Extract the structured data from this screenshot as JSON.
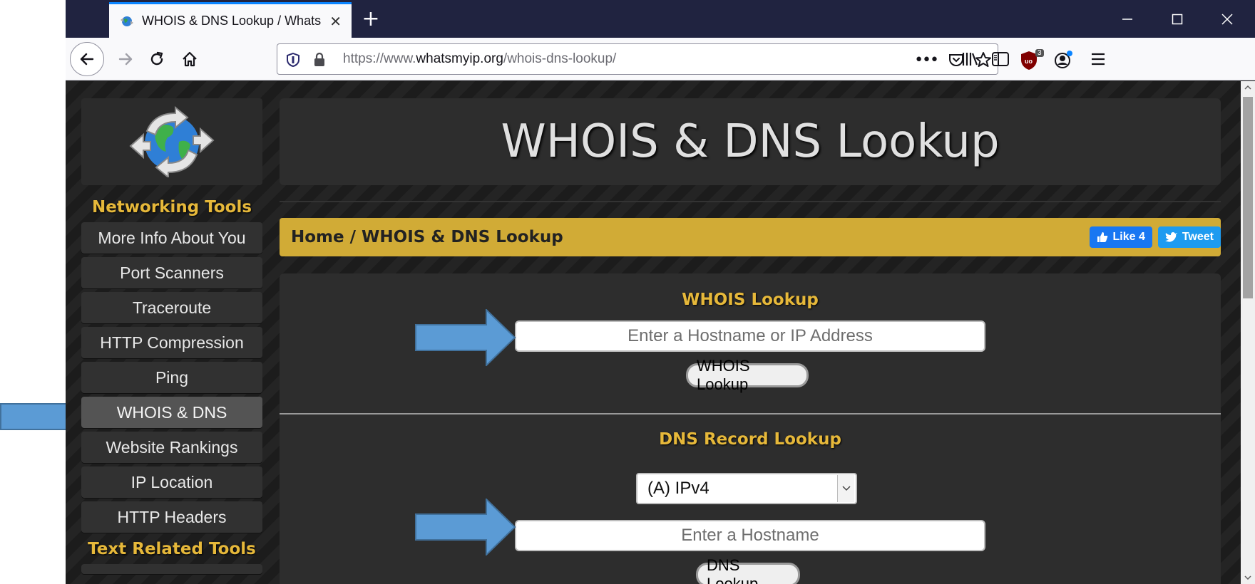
{
  "browser": {
    "tab_title": "WHOIS & DNS Lookup / Whats",
    "url_prefix": "https://www.",
    "url_domain": "whatsmyip.org",
    "url_path": "/whois-dns-lookup/",
    "ublock_count": "3"
  },
  "sidebar": {
    "section_title": "Networking Tools",
    "items": [
      {
        "label": "More Info About You"
      },
      {
        "label": "Port Scanners"
      },
      {
        "label": "Traceroute"
      },
      {
        "label": "HTTP Compression"
      },
      {
        "label": "Ping"
      },
      {
        "label": "WHOIS & DNS",
        "active": true
      },
      {
        "label": "Website Rankings"
      },
      {
        "label": "IP Location"
      },
      {
        "label": "HTTP Headers"
      }
    ],
    "section2_title": "Text Related Tools"
  },
  "main": {
    "page_title": "WHOIS & DNS Lookup",
    "breadcrumb": "Home / WHOIS & DNS Lookup",
    "fb_label": "Like 4",
    "tweet_label": "Tweet"
  },
  "whois": {
    "heading": "WHOIS Lookup",
    "placeholder": "Enter a Hostname or IP Address",
    "button": "WHOIS Lookup"
  },
  "dns": {
    "heading": "DNS Record Lookup",
    "record_type": "(A) IPv4",
    "placeholder": "Enter a Hostname",
    "button": "DNS Lookup"
  },
  "colors": {
    "accent_gold": "#d1ab36",
    "heading_gold": "#e6b83a",
    "annotation_arrow": "#5b9bd5"
  }
}
